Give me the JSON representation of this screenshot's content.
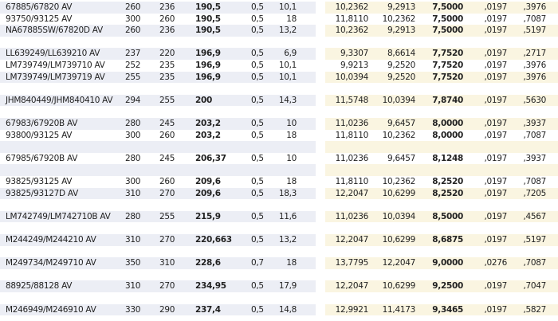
{
  "rows": [
    {
      "name": "67885/67820 AV",
      "d": "260",
      "D": "236",
      "T": "190,5",
      "r": "0,5",
      "w": "10,1",
      "in_d": "10,2362",
      "in_D": "9,2913",
      "in_T": "7,5000",
      "in_r": ",0197",
      "in_w": ",3976"
    },
    {
      "name": "93750/93125 AV",
      "d": "300",
      "D": "260",
      "T": "190,5",
      "r": "0,5",
      "w": "18",
      "in_d": "11,8110",
      "in_D": "10,2362",
      "in_T": "7,5000",
      "in_r": ",0197",
      "in_w": ",7087"
    },
    {
      "name": "NA67885SW/67820D AV",
      "d": "260",
      "D": "236",
      "T": "190,5",
      "r": "0,5",
      "w": "13,2",
      "in_d": "10,2362",
      "in_D": "9,2913",
      "in_T": "7,5000",
      "in_r": ",0197",
      "in_w": ",5197"
    },
    {},
    {
      "name": "LL639249/LL639210 AV",
      "d": "237",
      "D": "220",
      "T": "196,9",
      "r": "0,5",
      "w": "6,9",
      "in_d": "9,3307",
      "in_D": "8,6614",
      "in_T": "7,7520",
      "in_r": ",0197",
      "in_w": ",2717"
    },
    {
      "name": "LM739749/LM739710 AV",
      "d": "252",
      "D": "235",
      "T": "196,9",
      "r": "0,5",
      "w": "10,1",
      "in_d": "9,9213",
      "in_D": "9,2520",
      "in_T": "7,7520",
      "in_r": ",0197",
      "in_w": ",3976"
    },
    {
      "name": "LM739749/LM739719 AV",
      "d": "255",
      "D": "235",
      "T": "196,9",
      "r": "0,5",
      "w": "10,1",
      "in_d": "10,0394",
      "in_D": "9,2520",
      "in_T": "7,7520",
      "in_r": ",0197",
      "in_w": ",3976"
    },
    {},
    {
      "name": "JHM840449/JHM840410 AV",
      "d": "294",
      "D": "255",
      "T": "200",
      "r": "0,5",
      "w": "14,3",
      "in_d": "11,5748",
      "in_D": "10,0394",
      "in_T": "7,8740",
      "in_r": ",0197",
      "in_w": ",5630"
    },
    {},
    {
      "name": "67983/67920B AV",
      "d": "280",
      "D": "245",
      "T": "203,2",
      "r": "0,5",
      "w": "10",
      "in_d": "11,0236",
      "in_D": "9,6457",
      "in_T": "8,0000",
      "in_r": ",0197",
      "in_w": ",3937"
    },
    {
      "name": "93800/93125 AV",
      "d": "300",
      "D": "260",
      "T": "203,2",
      "r": "0,5",
      "w": "18",
      "in_d": "11,8110",
      "in_D": "10,2362",
      "in_T": "8,0000",
      "in_r": ",0197",
      "in_w": ",7087"
    },
    {},
    {
      "name": "67985/67920B AV",
      "d": "280",
      "D": "245",
      "T": "206,37",
      "r": "0,5",
      "w": "10",
      "in_d": "11,0236",
      "in_D": "9,6457",
      "in_T": "8,1248",
      "in_r": ",0197",
      "in_w": ",3937"
    },
    {},
    {
      "name": "93825/93125 AV",
      "d": "300",
      "D": "260",
      "T": "209,6",
      "r": "0,5",
      "w": "18",
      "in_d": "11,8110",
      "in_D": "10,2362",
      "in_T": "8,2520",
      "in_r": ",0197",
      "in_w": ",7087"
    },
    {
      "name": "93825/93127D AV",
      "d": "310",
      "D": "270",
      "T": "209,6",
      "r": "0,5",
      "w": "18,3",
      "in_d": "12,2047",
      "in_D": "10,6299",
      "in_T": "8,2520",
      "in_r": ",0197",
      "in_w": ",7205"
    },
    {},
    {
      "name": "LM742749/LM742710B AV",
      "d": "280",
      "D": "255",
      "T": "215,9",
      "r": "0,5",
      "w": "11,6",
      "in_d": "11,0236",
      "in_D": "10,0394",
      "in_T": "8,5000",
      "in_r": ",0197",
      "in_w": ",4567"
    },
    {},
    {
      "name": "M244249/M244210 AV",
      "d": "310",
      "D": "270",
      "T": "220,663",
      "r": "0,5",
      "w": "13,2",
      "in_d": "12,2047",
      "in_D": "10,6299",
      "in_T": "8,6875",
      "in_r": ",0197",
      "in_w": ",5197"
    },
    {},
    {
      "name": "M249734/M249710 AV",
      "d": "350",
      "D": "310",
      "T": "228,6",
      "r": "0,7",
      "w": "18",
      "in_d": "13,7795",
      "in_D": "12,2047",
      "in_T": "9,0000",
      "in_r": ",0276",
      "in_w": ",7087"
    },
    {},
    {
      "name": "88925/88128 AV",
      "d": "310",
      "D": "270",
      "T": "234,95",
      "r": "0,5",
      "w": "17,9",
      "in_d": "12,2047",
      "in_D": "10,6299",
      "in_T": "9,2500",
      "in_r": ",0197",
      "in_w": ",7047"
    },
    {},
    {
      "name": "M246949/M246910 AV",
      "d": "330",
      "D": "290",
      "T": "237,4",
      "r": "0,5",
      "w": "14,8",
      "in_d": "12,9921",
      "in_D": "11,4173",
      "in_T": "9,3465",
      "in_r": ",0197",
      "in_w": ",5827"
    }
  ]
}
